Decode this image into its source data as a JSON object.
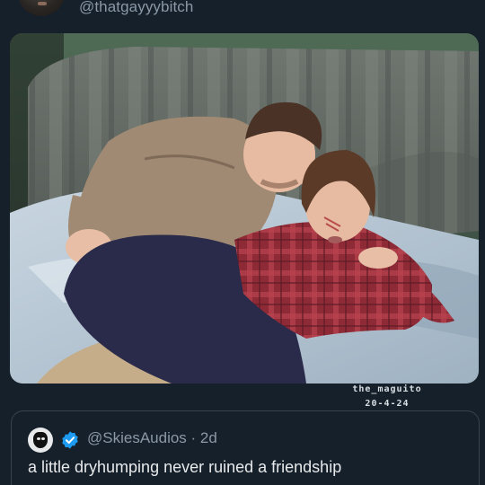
{
  "post": {
    "author_handle": "@thatgayyybitch"
  },
  "media": {
    "watermark_line1": "the_maguito",
    "watermark_line2": "20-4-24"
  },
  "quoted_post": {
    "handle": "@SkiesAudios",
    "separator": " · ",
    "time": "2d",
    "verified": true,
    "text": "a little dryhumping never ruined a friendship"
  },
  "colors": {
    "background": "#15202b",
    "secondary_text": "#8b98a5",
    "primary_text": "#e7e9ea",
    "verified_blue": "#1d9bf0",
    "card_border": "#38444d"
  }
}
